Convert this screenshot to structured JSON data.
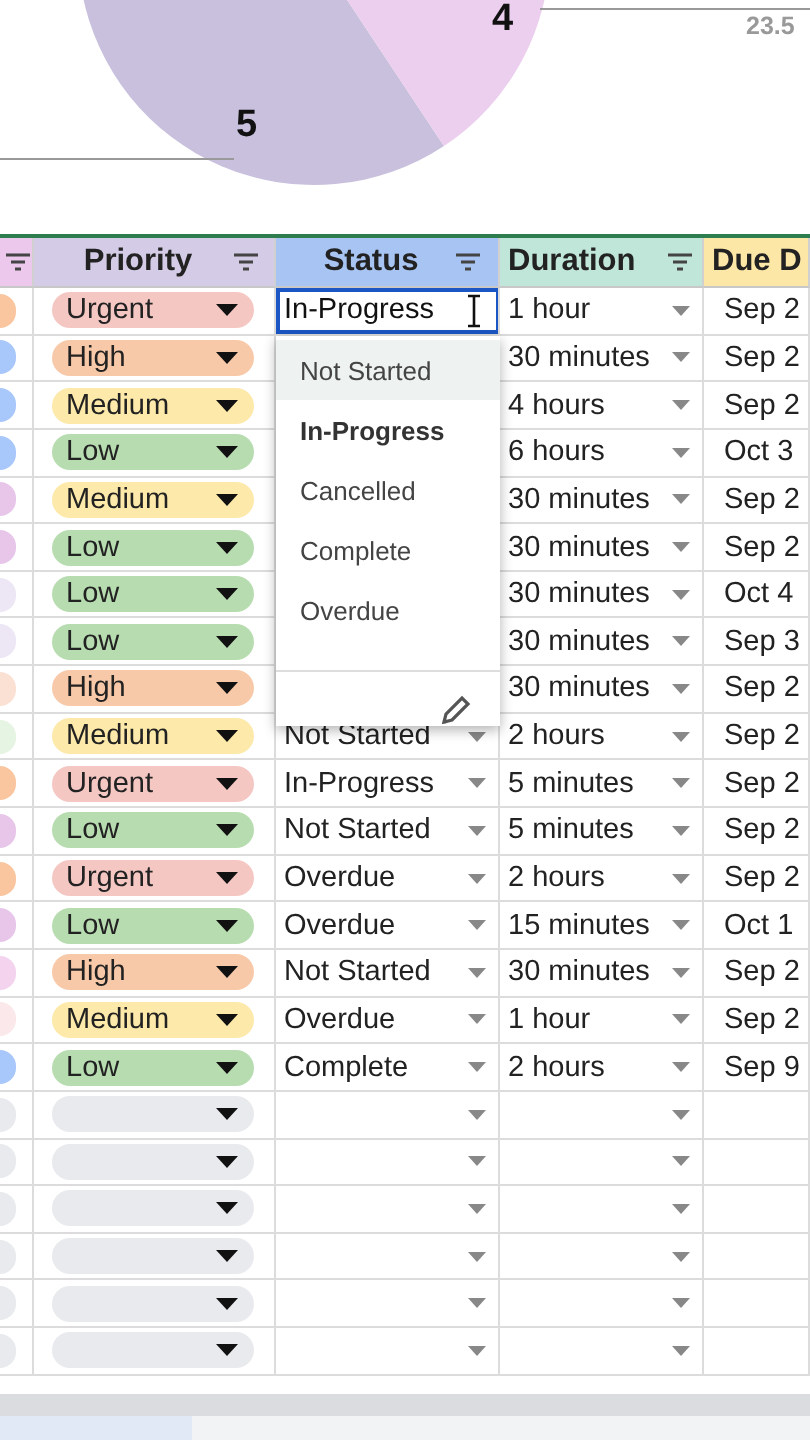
{
  "pie_chart": {
    "labels": [
      {
        "text": "5"
      },
      {
        "text": "4"
      },
      {
        "text": "23.5"
      }
    ]
  },
  "columns": [
    {
      "color": "#ecc8ec"
    },
    {
      "label": "Priority",
      "color": "#d4cbe6"
    },
    {
      "label": "Status",
      "color": "#a7c4f2"
    },
    {
      "label": "Duration",
      "color": "#bfe6d8"
    },
    {
      "label": "Due D",
      "color": "#fde7a6"
    }
  ],
  "status_editor": {
    "value": "In-Progress"
  },
  "status_menu": {
    "options": [
      {
        "label": "Not Started",
        "highlighted": true,
        "selected": false
      },
      {
        "label": "In-Progress",
        "highlighted": false,
        "selected": true
      },
      {
        "label": "Cancelled",
        "highlighted": false,
        "selected": false
      },
      {
        "label": "Complete",
        "highlighted": false,
        "selected": false
      },
      {
        "label": "Overdue",
        "highlighted": false,
        "selected": false
      }
    ]
  },
  "rows": [
    {
      "color": "#f9c6a0",
      "priority": {
        "label": "Urgent",
        "color": "#f4c7c3"
      },
      "duration": "1 hour",
      "due": "Sep 2"
    },
    {
      "color": "#a8c7fa",
      "priority": {
        "label": "High",
        "color": "#f8c9a8"
      },
      "duration": "30 minutes",
      "due": "Sep 2"
    },
    {
      "color": "#a8c7fa",
      "priority": {
        "label": "Medium",
        "color": "#fde9a9"
      },
      "duration": "4 hours",
      "due": "Sep 2"
    },
    {
      "color": "#a8c7fa",
      "priority": {
        "label": "Low",
        "color": "#b7dcb0"
      },
      "duration": "6 hours",
      "due": "Oct 3"
    },
    {
      "color": "#e8c6ea",
      "priority": {
        "label": "Medium",
        "color": "#fde9a9"
      },
      "duration": "30 minutes",
      "due": "Sep 2"
    },
    {
      "color": "#e8c6ea",
      "priority": {
        "label": "Low",
        "color": "#b7dcb0"
      },
      "duration": "30 minutes",
      "due": "Sep 2"
    },
    {
      "color": "#ece6f5",
      "priority": {
        "label": "Low",
        "color": "#b7dcb0"
      },
      "duration": "30 minutes",
      "due": "Oct 4"
    },
    {
      "color": "#ece6f5",
      "priority": {
        "label": "Low",
        "color": "#b7dcb0"
      },
      "duration": "30 minutes",
      "due": "Sep 3"
    },
    {
      "color": "#fbe1d3",
      "priority": {
        "label": "High",
        "color": "#f8c9a8"
      },
      "duration": "30 minutes",
      "due": "Sep 2"
    },
    {
      "color": "#e6f4e3",
      "priority": {
        "label": "Medium",
        "color": "#fde9a9"
      },
      "status": "Not Started",
      "duration": "2 hours",
      "due": "Sep 2"
    },
    {
      "color": "#f9c6a0",
      "priority": {
        "label": "Urgent",
        "color": "#f4c7c3"
      },
      "status": "In-Progress",
      "duration": "5 minutes",
      "due": "Sep 2"
    },
    {
      "color": "#e8c6ea",
      "priority": {
        "label": "Low",
        "color": "#b7dcb0"
      },
      "status": "Not Started",
      "duration": "5 minutes",
      "due": "Sep 2"
    },
    {
      "color": "#f9c6a0",
      "priority": {
        "label": "Urgent",
        "color": "#f4c7c3"
      },
      "status": "Overdue",
      "duration": "2 hours",
      "due": "Sep 2"
    },
    {
      "color": "#e8c6ea",
      "priority": {
        "label": "Low",
        "color": "#b7dcb0"
      },
      "status": "Overdue",
      "duration": "15 minutes",
      "due": "Oct 1"
    },
    {
      "color": "#f3d3ee",
      "priority": {
        "label": "High",
        "color": "#f8c9a8"
      },
      "status": "Not Started",
      "duration": "30 minutes",
      "due": "Sep 2"
    },
    {
      "color": "#fbe8ea",
      "priority": {
        "label": "Medium",
        "color": "#fde9a9"
      },
      "status": "Overdue",
      "duration": "1 hour",
      "due": "Sep 2"
    },
    {
      "color": "#a8c7fa",
      "priority": {
        "label": "Low",
        "color": "#b7dcb0"
      },
      "status": "Complete",
      "duration": "2 hours",
      "due": "Sep 9"
    },
    {
      "kind": "blank",
      "color": "#e8eaed",
      "priority": {
        "color": "#e8eaed"
      }
    },
    {
      "kind": "blank",
      "color": "#e8eaed",
      "priority": {
        "color": "#e8eaed"
      }
    },
    {
      "kind": "blank",
      "color": "#e8eaed",
      "priority": {
        "color": "#e8eaed"
      }
    },
    {
      "kind": "blank",
      "color": "#e8eaed",
      "priority": {
        "color": "#e8eaed"
      }
    },
    {
      "kind": "blank",
      "color": "#e8eaed",
      "priority": {
        "color": "#e8eaed"
      }
    },
    {
      "kind": "blank",
      "color": "#e8eaed",
      "priority": {
        "color": "#e8eaed"
      }
    }
  ]
}
